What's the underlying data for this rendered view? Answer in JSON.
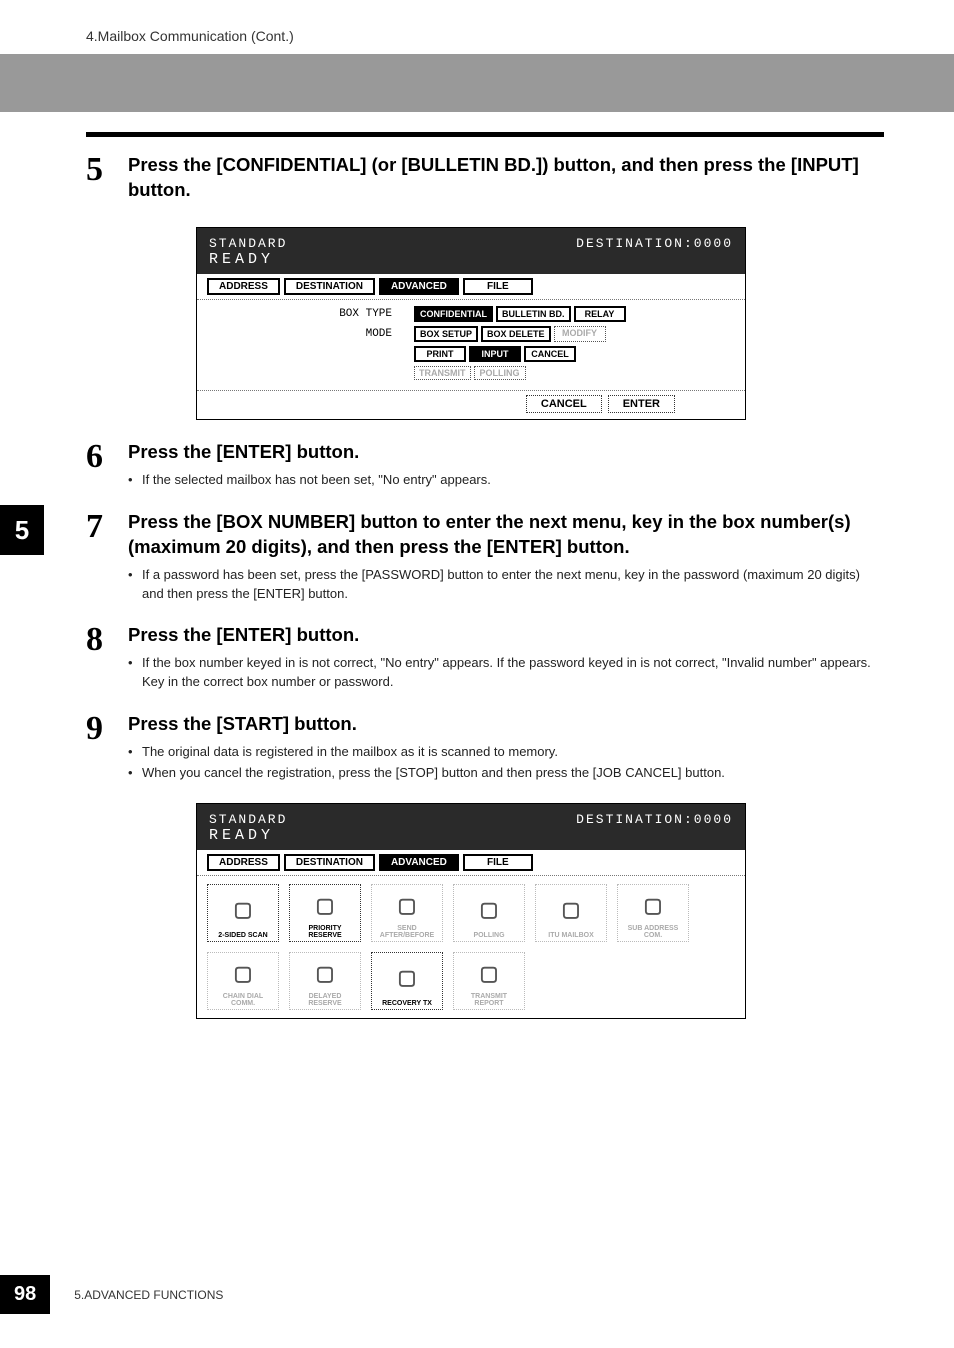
{
  "header": {
    "breadcrumb": "4.Mailbox Communication (Cont.)"
  },
  "side_tab": "5",
  "steps": {
    "s5": {
      "num": "5",
      "title": "Press the [CONFIDENTIAL] (or [BULLETIN BD.]) button, and then press the [INPUT] button."
    },
    "s6": {
      "num": "6",
      "title": "Press the [ENTER] button.",
      "bullets": [
        "If the selected mailbox has not been set, \"No entry\" appears."
      ]
    },
    "s7": {
      "num": "7",
      "title": "Press the [BOX NUMBER] button to enter the next menu, key in the box number(s) (maximum 20 digits), and then press the [ENTER] button.",
      "bullets": [
        "If a password has been set, press the [PASSWORD] button to enter the next menu, key in the password (maximum 20 digits) and then press the [ENTER] button."
      ]
    },
    "s8": {
      "num": "8",
      "title": "Press the [ENTER] button.",
      "bullets": [
        "If the box number keyed in is not correct, \"No entry\" appears. If the password keyed in is not correct, \"Invalid number\" appears. Key in the correct box number or password."
      ]
    },
    "s9": {
      "num": "9",
      "title": "Press the [START] button.",
      "bullets": [
        "The original data is registered in the mailbox as it is scanned to memory.",
        "When you cancel the registration, press the [STOP] button and then press the [JOB CANCEL] button."
      ]
    }
  },
  "screen1": {
    "lcd_line1_left": "STANDARD",
    "lcd_line1_right": "DESTINATION:0000",
    "lcd_line2": "READY",
    "tabs": {
      "address": "ADDRESS",
      "destination": "DESTINATION",
      "advanced": "ADVANCED",
      "file": "FILE"
    },
    "labels": {
      "box_type": "BOX TYPE",
      "mode": "MODE"
    },
    "buttons": {
      "confidential": "CONFIDENTIAL",
      "bulletin": "BULLETIN BD.",
      "relay": "RELAY",
      "box_setup": "BOX SETUP",
      "box_delete": "BOX DELETE",
      "modify": "MODIFY",
      "print": "PRINT",
      "input": "INPUT",
      "cancel": "CANCEL",
      "transmit": "TRANSMIT",
      "polling": "POLLING",
      "f_cancel": "CANCEL",
      "f_enter": "ENTER"
    }
  },
  "screen2": {
    "lcd_line1_left": "STANDARD",
    "lcd_line1_right": "DESTINATION:0000",
    "lcd_line2": "READY",
    "tabs": {
      "address": "ADDRESS",
      "destination": "DESTINATION",
      "advanced": "ADVANCED",
      "file": "FILE"
    },
    "icons": [
      {
        "label": "2-SIDED SCAN",
        "dim": false
      },
      {
        "label": "PRIORITY RESERVE",
        "dim": false
      },
      {
        "label": "SEND AFTER/BEFORE",
        "dim": true
      },
      {
        "label": "POLLING",
        "dim": true
      },
      {
        "label": "ITU MAILBOX",
        "dim": true
      },
      {
        "label": "SUB ADDRESS COM.",
        "dim": true
      },
      {
        "label": "CHAIN DIAL COMM.",
        "dim": true
      },
      {
        "label": "DELAYED RESERVE",
        "dim": true
      },
      {
        "label": "RECOVERY TX",
        "dim": false
      },
      {
        "label": "TRANSMIT REPORT",
        "dim": true
      }
    ]
  },
  "footer": {
    "page_num": "98",
    "text": "5.ADVANCED FUNCTIONS"
  }
}
